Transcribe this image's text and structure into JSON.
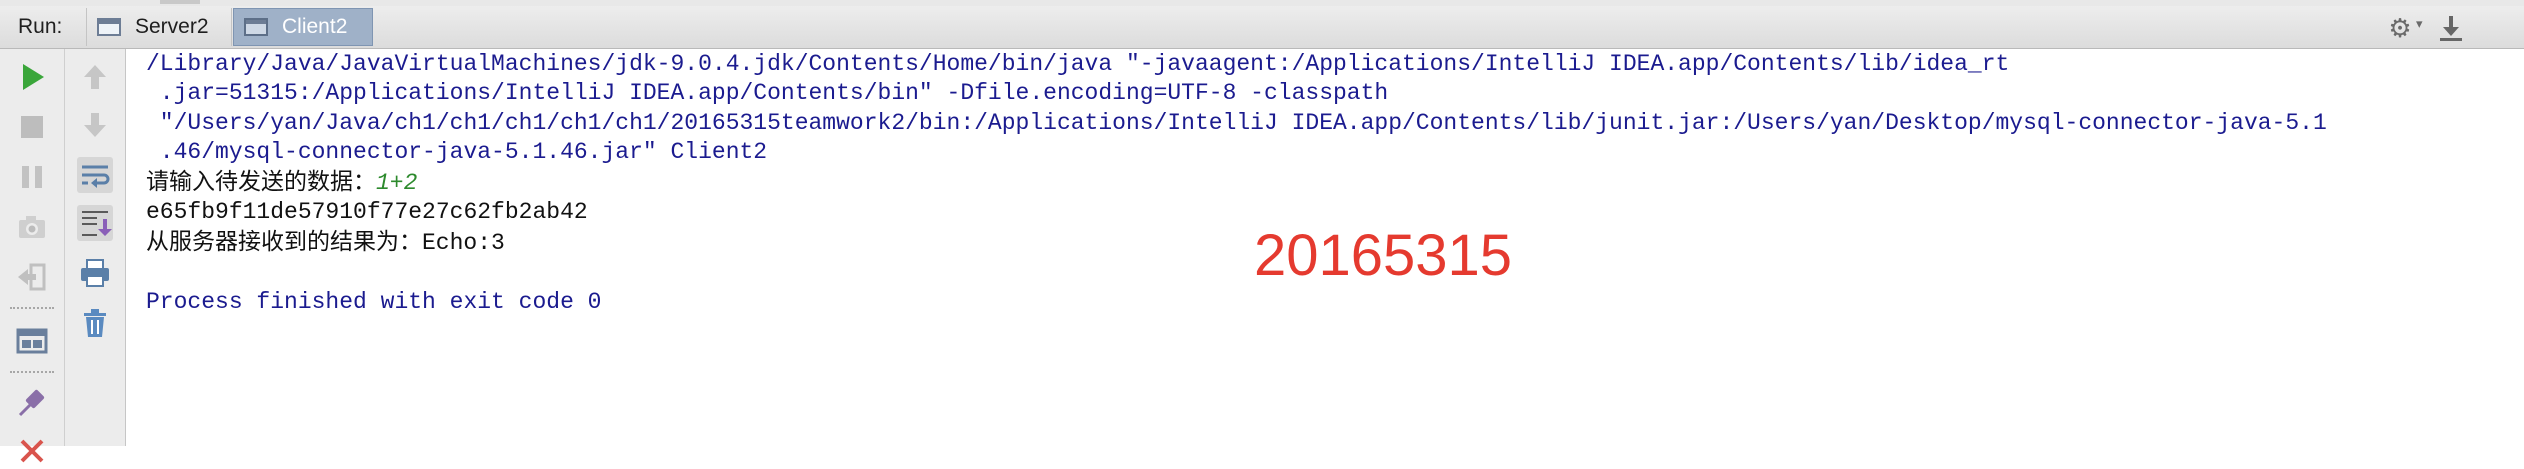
{
  "run_panel": {
    "label": "Run:",
    "tabs": [
      {
        "label": "Server2",
        "active": false,
        "icon": "console-window-icon"
      },
      {
        "label": "Client2",
        "active": true,
        "icon": "console-window-icon"
      }
    ],
    "icons_right": [
      "settings-gear-icon",
      "pin-down-icon"
    ]
  },
  "toolbar_left": {
    "buttons": [
      "run-icon",
      "stop-icon",
      "pause-icon",
      "dump-threads-icon",
      "exit-icon",
      "restore-layout-icon",
      "pin-tab-icon",
      "close-icon"
    ]
  },
  "toolbar_right": {
    "buttons": [
      "up-arrow-icon",
      "down-arrow-icon",
      "soft-wrap-icon",
      "scroll-to-end-icon",
      "print-icon",
      "trash-icon"
    ]
  },
  "console": {
    "lines": [
      "/Library/Java/JavaVirtualMachines/jdk-9.0.4.jdk/Contents/Home/bin/java \"-javaagent:/Applications/IntelliJ IDEA.app/Contents/lib/idea_rt",
      " .jar=51315:/Applications/IntelliJ IDEA.app/Contents/bin\" -Dfile.encoding=UTF-8 -classpath",
      " \"/Users/yan/Java/ch1/ch1/ch1/ch1/ch1/20165315teamwork2/bin:/Applications/IntelliJ IDEA.app/Contents/lib/junit.jar:/Users/yan/Desktop/mysql-connector-java-5.1",
      " .46/mysql-connector-java-5.1.46.jar\" Client2"
    ],
    "prompt": "请输入待发送的数据：",
    "user_input": "1+2",
    "hash": "e65fb9f11de57910f77e27c62fb2ab42",
    "result_prefix": "从服务器接收到的结果为：",
    "result_value": "Echo:3",
    "finish": "Process finished with exit code 0"
  },
  "watermark": "20165315",
  "colors": {
    "command": "#1b1b8f",
    "input": "#2d8a2d",
    "watermark": "#e53a2f",
    "active_tab": "#9fb1c8"
  }
}
